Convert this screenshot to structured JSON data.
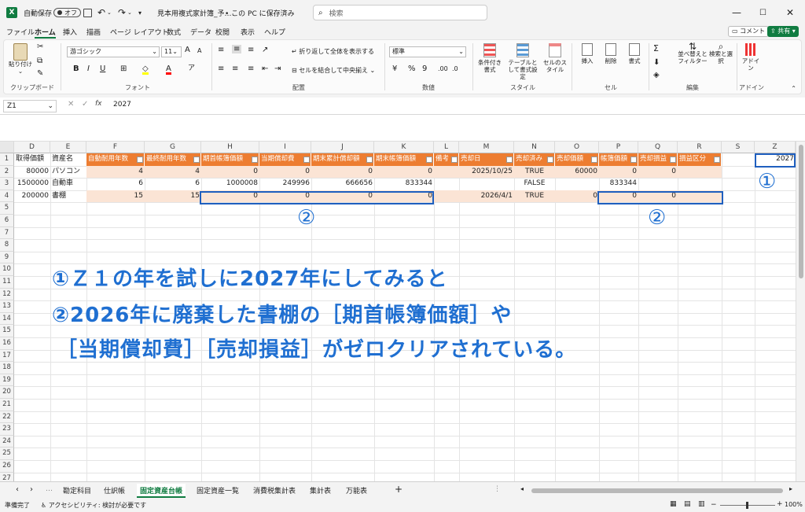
{
  "titlebar": {
    "autosave_label": "自動保存",
    "autosave_state": "オフ",
    "filename": "見本用複式家計簿_予…",
    "save_location": "• この PC に保存済み",
    "search_placeholder": "検索"
  },
  "ribbon_tabs": [
    "ファイル",
    "ホーム",
    "挿入",
    "描画",
    "ページ レイアウト",
    "数式",
    "データ",
    "校閲",
    "表示",
    "ヘルプ"
  ],
  "ribbon_right": {
    "comment": "コメント",
    "share": "共有"
  },
  "ribbon": {
    "clipboard": {
      "paste": "貼り付け",
      "label": "クリップボード"
    },
    "font": {
      "name": "游ゴシック",
      "size": "11",
      "label": "フォント"
    },
    "align": {
      "wrap": "折り返して全体を表示する",
      "merge": "セルを結合して中央揃え",
      "label": "配置"
    },
    "number": {
      "format": "標準",
      "label": "数値"
    },
    "style": {
      "cond": "条件付き書式",
      "table": "テーブルとして書式設定",
      "cellstyle": "セルのスタイル",
      "label": "スタイル"
    },
    "cells": {
      "insert": "挿入",
      "delete": "削除",
      "format": "書式",
      "label": "セル"
    },
    "edit": {
      "sort": "並べ替えとフィルター",
      "find": "検索と選択",
      "label": "編集"
    },
    "addin": {
      "addin": "アドイン",
      "label": "アドイン"
    }
  },
  "formulabar": {
    "namebox": "Z1",
    "fx": "fx",
    "value": "2027"
  },
  "columns": [
    "D",
    "E",
    "F",
    "G",
    "H",
    "I",
    "J",
    "K",
    "L",
    "M",
    "N",
    "O",
    "P",
    "Q",
    "R",
    "S",
    "Z"
  ],
  "rows": [
    "1",
    "2",
    "3",
    "4",
    "5",
    "6",
    "7",
    "8",
    "9",
    "10",
    "11",
    "12",
    "13",
    "14",
    "15",
    "16",
    "17",
    "18",
    "19",
    "20",
    "21",
    "22",
    "23",
    "24",
    "25",
    "26",
    "27",
    "28"
  ],
  "headers": {
    "D": "取得価額",
    "E": "資産名",
    "F": "自動耐用年数",
    "G": "最終耐用年数",
    "H": "期首帳簿価額",
    "I": "当期償却費",
    "J": "期末累計償却額",
    "K": "期末帳簿価額",
    "L": "備考",
    "M": "売却日",
    "N": "売却済み",
    "O": "売却価額",
    "P": "帳簿価額",
    "Q": "売却損益",
    "R": "損益区分",
    "Z": "2027"
  },
  "data_rows": [
    {
      "D": "80000",
      "E": "パソコン",
      "F": "4",
      "G": "4",
      "H": "0",
      "I": "0",
      "J": "0",
      "K": "0",
      "M": "2025/10/25",
      "N": "TRUE",
      "O": "60000",
      "P": "0",
      "Q": "0"
    },
    {
      "D": "1500000",
      "E": "自動車",
      "F": "6",
      "G": "6",
      "H": "1000008",
      "I": "249996",
      "J": "666656",
      "K": "833344",
      "N": "FALSE",
      "P": "833344"
    },
    {
      "D": "200000",
      "E": "書棚",
      "F": "15",
      "G": "15",
      "H": "0",
      "I": "0",
      "J": "0",
      "K": "0",
      "M": "2026/4/1",
      "N": "TRUE",
      "O": "0",
      "P": "0",
      "Q": "0"
    }
  ],
  "markers": {
    "one": "①",
    "two_a": "②",
    "two_b": "②"
  },
  "annotations": [
    "①Ｚ１の年を試しに2027年にしてみると",
    "②2026年に廃棄した書棚の［期首帳簿価額］や",
    "［当期償却費］［売却損益］がゼロクリアされている。"
  ],
  "sheet_tabs": [
    "勘定科目",
    "仕訳帳",
    "固定資産台帳",
    "固定資産一覧",
    "消費税集計表",
    "集計表",
    "万能表"
  ],
  "active_sheet": "固定資産台帳",
  "status": {
    "ready": "準備完了",
    "accessibility": "アクセシビリティ: 検討が必要です",
    "zoom": "100%"
  },
  "colors": {
    "accent": "#ed7d31",
    "band": "#fbe4d5",
    "annotation": "#1f6fd1",
    "excel_green": "#107c41"
  }
}
